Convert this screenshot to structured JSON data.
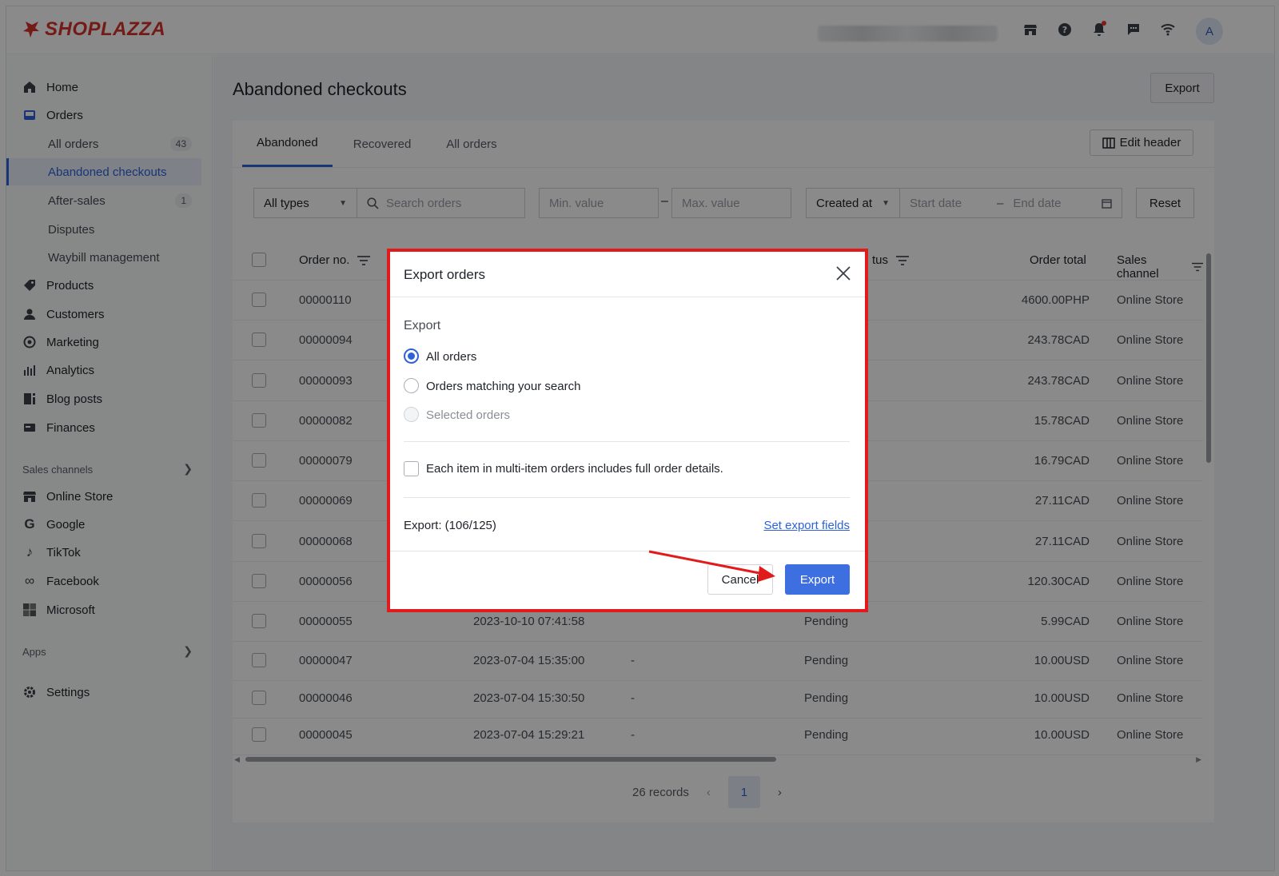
{
  "brand": {
    "name": "SHOPLAZZA",
    "color": "#d6312c"
  },
  "topbar": {
    "icons": [
      "store-icon",
      "help-icon",
      "bell-icon",
      "chat-icon",
      "wifi-icon"
    ],
    "avatar_letter": "A"
  },
  "sidebar": {
    "items": [
      {
        "label": "Home",
        "icon": "home-icon"
      },
      {
        "label": "Orders",
        "icon": "orders-icon"
      },
      {
        "label": "All orders",
        "badge": "43"
      },
      {
        "label": "Abandoned checkouts",
        "active": true
      },
      {
        "label": "After-sales",
        "badge": "1"
      },
      {
        "label": "Disputes"
      },
      {
        "label": "Waybill management"
      },
      {
        "label": "Products",
        "icon": "tag-icon"
      },
      {
        "label": "Customers",
        "icon": "person-icon"
      },
      {
        "label": "Marketing",
        "icon": "marketing-icon"
      },
      {
        "label": "Analytics",
        "icon": "chart-icon"
      },
      {
        "label": "Blog posts",
        "icon": "blog-icon"
      },
      {
        "label": "Finances",
        "icon": "finance-icon"
      }
    ],
    "sales_channels_label": "Sales channels",
    "channels": [
      {
        "label": "Online Store",
        "icon": "store-icon"
      },
      {
        "label": "Google",
        "icon": "google-icon"
      },
      {
        "label": "TikTok",
        "icon": "tiktok-icon"
      },
      {
        "label": "Facebook",
        "icon": "meta-icon"
      },
      {
        "label": "Microsoft",
        "icon": "microsoft-icon"
      }
    ],
    "apps_label": "Apps",
    "settings_label": "Settings"
  },
  "page": {
    "title": "Abandoned checkouts",
    "export_label": "Export",
    "tabs": [
      "Abandoned",
      "Recovered",
      "All orders"
    ],
    "edit_header_label": "Edit header",
    "filters": {
      "type_value": "All types",
      "search_placeholder": "Search orders",
      "min_placeholder": "Min. value",
      "max_placeholder": "Max. value",
      "date_field_value": "Created at",
      "start_placeholder": "Start date",
      "end_placeholder": "End date",
      "reset_label": "Reset"
    }
  },
  "table": {
    "headers": {
      "order_no": "Order no.",
      "status": "tus",
      "order_total": "Order total",
      "sales_channel": "Sales channel"
    },
    "rows": [
      {
        "order_no": "00000110",
        "created": "",
        "customer": "",
        "status": "",
        "total": "4600.00PHP",
        "channel": "Online Store"
      },
      {
        "order_no": "00000094",
        "created": "",
        "customer": "",
        "status": "",
        "total": "243.78CAD",
        "channel": "Online Store"
      },
      {
        "order_no": "00000093",
        "created": "",
        "customer": "",
        "status": "",
        "total": "243.78CAD",
        "channel": "Online Store"
      },
      {
        "order_no": "00000082",
        "created": "",
        "customer": "",
        "status": "",
        "total": "15.78CAD",
        "channel": "Online Store"
      },
      {
        "order_no": "00000079",
        "created": "",
        "customer": "",
        "status": "",
        "total": "16.79CAD",
        "channel": "Online Store"
      },
      {
        "order_no": "00000069",
        "created": "",
        "customer": "",
        "status": "",
        "total": "27.11CAD",
        "channel": "Online Store"
      },
      {
        "order_no": "00000068",
        "created": "",
        "customer": "",
        "status": "",
        "total": "27.11CAD",
        "channel": "Online Store"
      },
      {
        "order_no": "00000056",
        "created": "",
        "customer": "",
        "status": "",
        "total": "120.30CAD",
        "channel": "Online Store"
      },
      {
        "order_no": "00000055",
        "created": "2023-10-10 07:41:58",
        "customer": "",
        "status": "Pending",
        "total": "5.99CAD",
        "channel": "Online Store"
      },
      {
        "order_no": "00000047",
        "created": "2023-07-04 15:35:00",
        "customer": "-",
        "status": "Pending",
        "total": "10.00USD",
        "channel": "Online Store"
      },
      {
        "order_no": "00000046",
        "created": "2023-07-04 15:30:50",
        "customer": "-",
        "status": "Pending",
        "total": "10.00USD",
        "channel": "Online Store"
      },
      {
        "order_no": "00000045",
        "created": "2023-07-04 15:29:21",
        "customer": "-",
        "status": "Pending",
        "total": "10.00USD",
        "channel": "Online Store"
      }
    ]
  },
  "pagination": {
    "records": "26 records",
    "current_page": "1"
  },
  "modal": {
    "title": "Export orders",
    "section_label": "Export",
    "options": [
      "All orders",
      "Orders matching your search",
      "Selected orders"
    ],
    "selected_option": "All orders",
    "checkbox_label": "Each item in multi-item orders includes full order details.",
    "count_label": "Export: (106/125)",
    "fields_link": "Set export fields",
    "cancel_label": "Cancel",
    "export_label": "Export",
    "highlight_color": "#e11b1b",
    "primary_color": "#3e6fe0"
  }
}
